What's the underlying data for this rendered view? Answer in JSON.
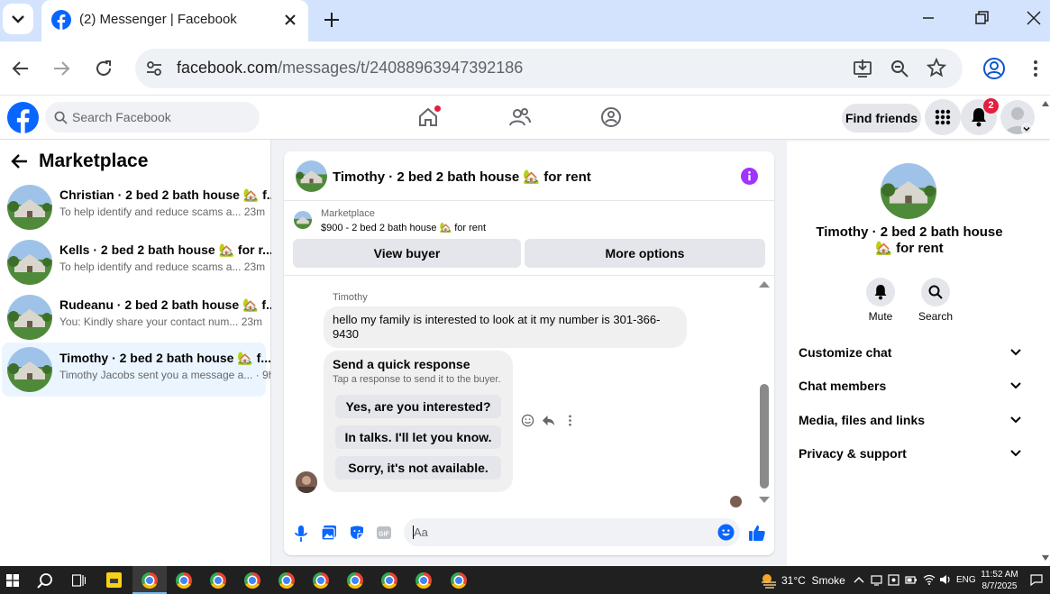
{
  "browser": {
    "tab_title": "(2) Messenger | Facebook",
    "url_host": "facebook.com",
    "url_path": "/messages/t/24088963947392186"
  },
  "fb_header": {
    "search_placeholder": "Search Facebook",
    "find_friends": "Find friends",
    "notification_count": "2"
  },
  "sidebar": {
    "title": "Marketplace",
    "conversations": [
      {
        "title": "Christian · 2 bed 2 bath house 🏡 f...",
        "preview": "To help identify and reduce scams a...",
        "time": "23m"
      },
      {
        "title": "Kells · 2 bed 2 bath house 🏡 for r...",
        "preview": "To help identify and reduce scams a...",
        "time": "23m"
      },
      {
        "title": "Rudeanu · 2 bed 2 bath house 🏡 f...",
        "preview": "You: Kindly share your contact num...",
        "time": "23m"
      },
      {
        "title": "Timothy · 2 bed 2 bath house 🏡 f...",
        "preview": "Timothy Jacobs sent you a message a...",
        "time": "9h"
      }
    ]
  },
  "chat": {
    "header_title": "Timothy · 2 bed 2 bath house 🏡 for rent",
    "listing_label": "Marketplace",
    "listing_detail": "$900 - 2 bed 2 bath house 🏡 for rent",
    "view_buyer": "View buyer",
    "more_options": "More options",
    "sender_name": "Timothy",
    "message": "hello my family is interested to look at it my number is 301-366-9430",
    "quick_title": "Send a quick response",
    "quick_subtitle": "Tap a response to send it to the buyer.",
    "quick_replies": [
      "Yes, are you interested?",
      "In talks. I'll let you know.",
      "Sorry, it's not available."
    ],
    "composer_placeholder": "Aa"
  },
  "details": {
    "title": "Timothy · 2 bed 2 bath house 🏡 for rent",
    "mute": "Mute",
    "search": "Search",
    "sections": [
      "Customize chat",
      "Chat members",
      "Media, files and links",
      "Privacy & support"
    ]
  },
  "taskbar": {
    "weather": "31°C  Smoke",
    "lang": "ENG",
    "time": "11:52 AM",
    "date": "8/7/2025"
  },
  "colors": {
    "fb_blue": "#0866ff",
    "tabstrip": "#d3e3fd",
    "accent_purple": "#a033ff"
  }
}
